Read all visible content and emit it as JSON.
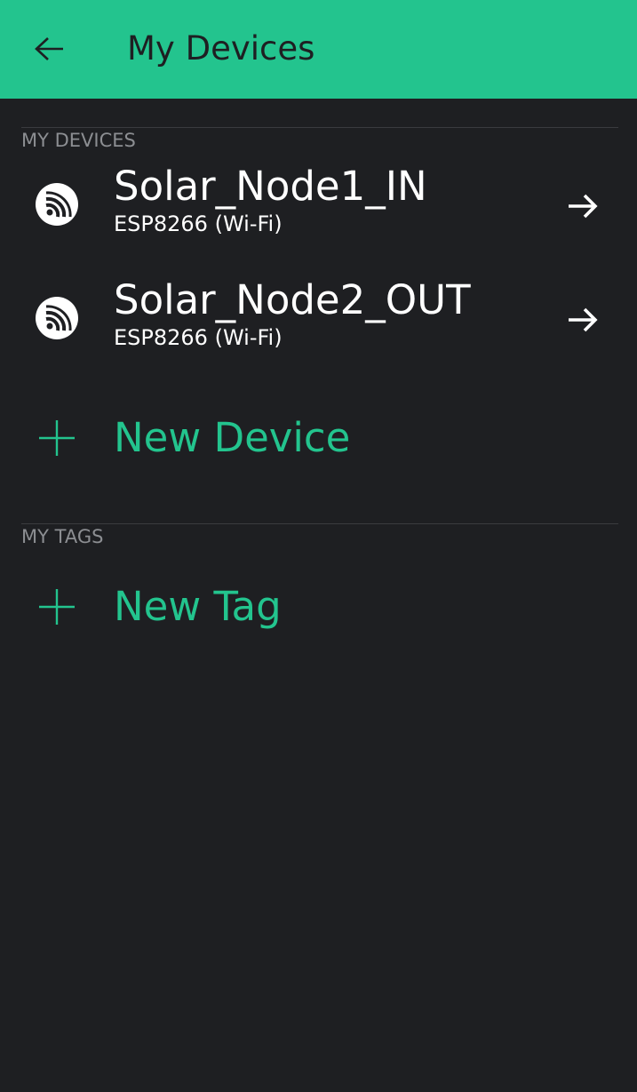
{
  "header": {
    "title": "My Devices",
    "back_icon": "arrow-left-icon",
    "background": "#23c48e"
  },
  "sections": {
    "devices_label": "MY DEVICES",
    "tags_label": "MY TAGS"
  },
  "devices": [
    {
      "name": "Solar_Node1_IN",
      "type": "ESP8266 (Wi-Fi)",
      "icon": "espressif-icon",
      "action_icon": "arrow-right-icon"
    },
    {
      "name": "Solar_Node2_OUT",
      "type": "ESP8266 (Wi-Fi)",
      "icon": "espressif-icon",
      "action_icon": "arrow-right-icon"
    }
  ],
  "actions": {
    "new_device_label": "New Device",
    "new_tag_label": "New Tag",
    "accent": "#23c48e"
  }
}
